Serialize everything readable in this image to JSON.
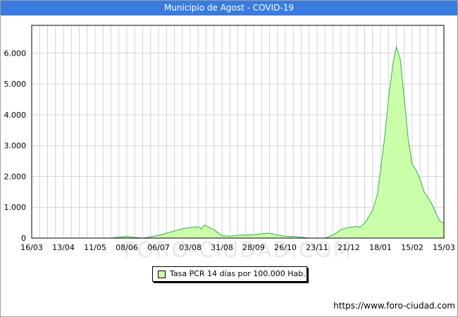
{
  "title": "Municipio de Agost - COVID-19",
  "footer": "https://www.foro-ciudad.com",
  "watermark": "FORO-CIUDAD.COM",
  "chart_data": {
    "type": "area",
    "title": "Municipio de Agost - COVID-19",
    "xlabel": "",
    "ylabel": "",
    "x_ticks": [
      "16/03",
      "13/04",
      "11/05",
      "08/06",
      "06/07",
      "03/08",
      "31/08",
      "28/09",
      "26/10",
      "23/11",
      "21/12",
      "18/01",
      "15/02",
      "15/03"
    ],
    "y_ticks": [
      "0",
      "1.000",
      "2.000",
      "3.000",
      "4.000",
      "5.000",
      "6.000"
    ],
    "y_tick_values": [
      0,
      1000,
      2000,
      3000,
      4000,
      5000,
      6000
    ],
    "ylim": [
      0,
      6900
    ],
    "x_weeks": [
      0,
      52
    ],
    "grid": true,
    "legend_position": "bottom-center",
    "colors": {
      "fill": "#ccffaa",
      "line": "#33aa55",
      "title_bar": "#3a7be0"
    },
    "series": [
      {
        "name": "Tasa PCR 14 días por 100.000 Hab.",
        "points": [
          [
            0,
            0
          ],
          [
            10,
            0
          ],
          [
            11,
            30
          ],
          [
            12,
            50
          ],
          [
            13,
            20
          ],
          [
            14,
            0
          ],
          [
            14.6,
            20
          ],
          [
            16,
            90
          ],
          [
            17,
            160
          ],
          [
            18,
            230
          ],
          [
            19,
            300
          ],
          [
            20,
            340
          ],
          [
            21,
            370
          ],
          [
            21.4,
            300
          ],
          [
            21.8,
            420
          ],
          [
            23,
            270
          ],
          [
            24,
            80
          ],
          [
            25,
            60
          ],
          [
            26,
            90
          ],
          [
            27,
            100
          ],
          [
            28,
            110
          ],
          [
            29,
            140
          ],
          [
            30,
            160
          ],
          [
            31,
            100
          ],
          [
            32,
            60
          ],
          [
            33,
            50
          ],
          [
            34,
            30
          ],
          [
            35,
            0
          ],
          [
            36,
            0
          ],
          [
            36.5,
            0
          ],
          [
            37,
            0
          ],
          [
            38,
            100
          ],
          [
            39,
            270
          ],
          [
            40,
            350
          ],
          [
            41,
            380
          ],
          [
            41.4,
            350
          ],
          [
            42,
            480
          ],
          [
            43,
            900
          ],
          [
            43.6,
            1400
          ],
          [
            44,
            2200
          ],
          [
            44.5,
            3200
          ],
          [
            45,
            4500
          ],
          [
            45.6,
            5700
          ],
          [
            46,
            6200
          ],
          [
            46.5,
            5800
          ],
          [
            47,
            4500
          ],
          [
            47.5,
            3200
          ],
          [
            48,
            2400
          ],
          [
            48.5,
            2200
          ],
          [
            49,
            1900
          ],
          [
            49.5,
            1500
          ],
          [
            50,
            1300
          ],
          [
            50.5,
            1100
          ],
          [
            51,
            800
          ],
          [
            51.5,
            550
          ],
          [
            52,
            480
          ],
          [
            52.5,
            250
          ],
          [
            53,
            600
          ]
        ]
      }
    ]
  }
}
